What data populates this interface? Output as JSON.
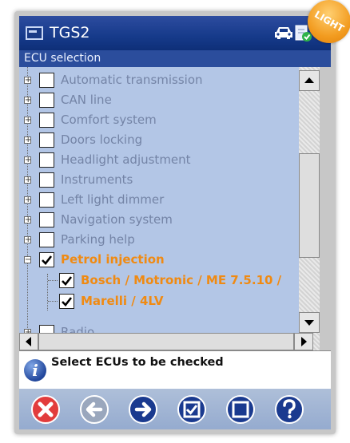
{
  "app": {
    "title": "TGS2",
    "badge": "LIGHT"
  },
  "section_header": "ECU selection",
  "tree": {
    "items": [
      {
        "label": "Automatic transmission",
        "checked": false,
        "expander": "+"
      },
      {
        "label": "CAN line",
        "checked": false,
        "expander": "+"
      },
      {
        "label": "Comfort system",
        "checked": false,
        "expander": "+"
      },
      {
        "label": "Doors locking",
        "checked": false,
        "expander": "+"
      },
      {
        "label": "Headlight adjustment",
        "checked": false,
        "expander": "+"
      },
      {
        "label": "Instruments",
        "checked": false,
        "expander": "+"
      },
      {
        "label": "Left light dimmer",
        "checked": false,
        "expander": "+"
      },
      {
        "label": "Navigation system",
        "checked": false,
        "expander": "+"
      },
      {
        "label": "Parking help",
        "checked": false,
        "expander": "+"
      },
      {
        "label": "Petrol injection",
        "checked": true,
        "expander": "−"
      },
      {
        "label": "Bosch / Motronic / ME 7.5.10 /",
        "checked": true,
        "child": true
      },
      {
        "label": "Marelli / 4LV",
        "checked": true,
        "child": true
      },
      {
        "label": "Radio",
        "checked": false,
        "expander": "+"
      }
    ]
  },
  "info": {
    "text": "Select ECUs to be checked",
    "icon": "info-icon"
  },
  "toolbar": {
    "buttons": [
      "cancel-icon",
      "back-icon",
      "forward-icon",
      "check-all-icon",
      "uncheck-all-icon",
      "help-icon"
    ]
  },
  "colors": {
    "title_bar": "#163a8a",
    "list_bg": "#b3c6e6",
    "unselected_text": "#7484a6",
    "selected_text": "#f08a12",
    "badge": "#f29b1f",
    "cancel": "#e23c3c",
    "nav": "#1a3a8f"
  }
}
